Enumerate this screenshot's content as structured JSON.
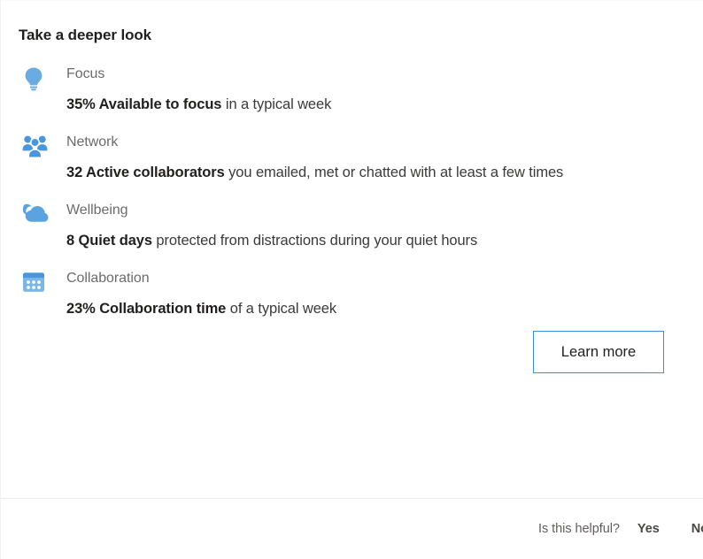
{
  "card": {
    "title": "Take a deeper look",
    "insights": [
      {
        "icon": "lightbulb-icon",
        "category": "Focus",
        "highlight": "35% Available to focus",
        "rest": " in a typical week",
        "accent": "#6aabe4"
      },
      {
        "icon": "people-group-icon",
        "category": "Network",
        "highlight": "32 Active collaborators",
        "rest": " you emailed, met or chatted with at least a few times",
        "accent": "#4a96dc"
      },
      {
        "icon": "cloud-moon-icon",
        "category": "Wellbeing",
        "highlight": "8 Quiet days",
        "rest": " protected from distractions during your quiet hours",
        "accent": "#5aa3e0"
      },
      {
        "icon": "calendar-icon",
        "category": "Collaboration",
        "highlight": "23% Collaboration time",
        "rest": " of a typical week",
        "accent": "#6aabe4"
      }
    ],
    "learn_more_label": "Learn more",
    "footer": {
      "question": "Is this helpful?",
      "yes_label": "Yes",
      "no_label": "No"
    }
  },
  "colors": {
    "accent_blue": "#6aabe4",
    "button_border": "#3a8dde",
    "text_primary": "#201f1e",
    "text_secondary": "#6b6b6b",
    "divider": "#edebe9"
  }
}
